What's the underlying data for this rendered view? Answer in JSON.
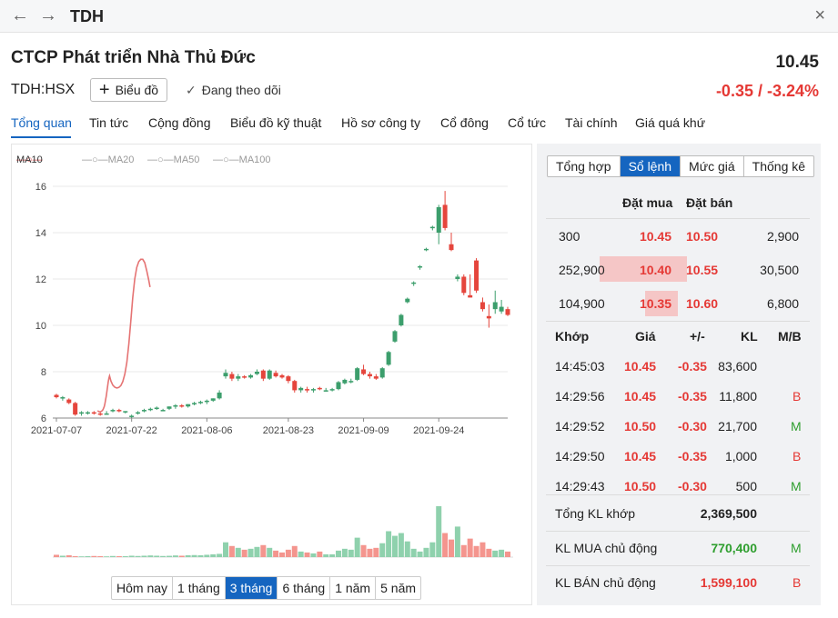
{
  "window": {
    "title": "TDH",
    "back_icon": "←",
    "forward_icon": "→",
    "close_icon": "×"
  },
  "header": {
    "company": "CTCP Phát triển Nhà Thủ Đức",
    "price": "10.45",
    "ticker": "TDH:HSX",
    "chart_button": "Biểu đồ",
    "follow_label": "Đang theo dõi",
    "change": "-0.35 / -3.24%"
  },
  "tabs": [
    "Tổng quan",
    "Tin tức",
    "Cộng đồng",
    "Biểu đồ kỹ thuật",
    "Hồ sơ công ty",
    "Cổ đông",
    "Cổ tức",
    "Tài chính",
    "Giá quá khứ"
  ],
  "legend": [
    "MA10",
    "MA20",
    "MA50",
    "MA100"
  ],
  "ranges": [
    "Hôm nay",
    "1 tháng",
    "3 tháng",
    "6 tháng",
    "1 năm",
    "5 năm"
  ],
  "right_tabs": [
    "Tổng hợp",
    "Sổ lệnh",
    "Mức giá",
    "Thống kê"
  ],
  "orderbook": {
    "buy_header": "Đặt mua",
    "sell_header": "Đặt bán",
    "rows": [
      {
        "buy_vol": "300",
        "buy_price": "10.45",
        "sell_price": "10.50",
        "sell_vol": "2,900"
      },
      {
        "buy_vol": "252,900",
        "buy_price": "10.40",
        "sell_price": "10.55",
        "sell_vol": "30,500"
      },
      {
        "buy_vol": "104,900",
        "buy_price": "10.35",
        "sell_price": "10.60",
        "sell_vol": "6,800"
      }
    ]
  },
  "trades": {
    "headers": [
      "Khớp",
      "Giá",
      "+/-",
      "KL",
      "M/B"
    ],
    "rows": [
      {
        "time": "14:45:03",
        "price": "10.45",
        "change": "-0.35",
        "vol": "83,600",
        "side": ""
      },
      {
        "time": "14:29:56",
        "price": "10.45",
        "change": "-0.35",
        "vol": "11,800",
        "side": "B"
      },
      {
        "time": "14:29:52",
        "price": "10.50",
        "change": "-0.30",
        "vol": "21,700",
        "side": "M"
      },
      {
        "time": "14:29:50",
        "price": "10.45",
        "change": "-0.35",
        "vol": "1,000",
        "side": "B"
      },
      {
        "time": "14:29:43",
        "price": "10.50",
        "change": "-0.30",
        "vol": "500",
        "side": "M"
      }
    ]
  },
  "totals": [
    {
      "label": "Tổng KL khớp",
      "value": "2,369,500",
      "side": ""
    },
    {
      "label": "KL MUA chủ động",
      "value": "770,400",
      "side": "M"
    },
    {
      "label": "KL BÁN chủ động",
      "value": "1,599,100",
      "side": "B"
    }
  ],
  "chart_data": {
    "type": "candlestick",
    "ylim": [
      6,
      16.5
    ],
    "yticks": [
      "6",
      "8",
      "10",
      "12",
      "14",
      "16"
    ],
    "xticks": [
      "2021-07-07",
      "2021-07-22",
      "2021-08-06",
      "2021-08-23",
      "2021-09-09",
      "2021-09-24"
    ],
    "ohlc": [
      [
        7.0,
        7.05,
        6.85,
        6.9
      ],
      [
        6.85,
        6.95,
        6.75,
        6.9
      ],
      [
        6.8,
        6.85,
        6.6,
        6.65
      ],
      [
        6.65,
        6.7,
        6.1,
        6.15
      ],
      [
        6.2,
        6.3,
        6.1,
        6.25
      ],
      [
        6.2,
        6.3,
        6.15,
        6.25
      ],
      [
        6.25,
        6.3,
        6.15,
        6.2
      ],
      [
        6.2,
        6.25,
        6.1,
        6.15
      ],
      [
        6.2,
        6.3,
        6.15,
        6.2
      ],
      [
        6.3,
        6.4,
        6.25,
        6.35
      ],
      [
        6.35,
        6.4,
        6.25,
        6.3
      ],
      [
        6.25,
        6.3,
        6.2,
        6.3
      ],
      [
        6.1,
        6.15,
        6.0,
        6.1
      ],
      [
        6.2,
        6.3,
        6.15,
        6.25
      ],
      [
        6.3,
        6.4,
        6.25,
        6.35
      ],
      [
        6.35,
        6.45,
        6.3,
        6.4
      ],
      [
        6.4,
        6.5,
        6.35,
        6.45
      ],
      [
        6.35,
        6.4,
        6.3,
        6.35
      ],
      [
        6.4,
        6.5,
        6.35,
        6.5
      ],
      [
        6.5,
        6.6,
        6.4,
        6.55
      ],
      [
        6.55,
        6.6,
        6.45,
        6.5
      ],
      [
        6.5,
        6.6,
        6.45,
        6.6
      ],
      [
        6.6,
        6.7,
        6.55,
        6.65
      ],
      [
        6.65,
        6.75,
        6.6,
        6.7
      ],
      [
        6.7,
        6.8,
        6.6,
        6.75
      ],
      [
        6.75,
        6.85,
        6.7,
        6.85
      ],
      [
        6.85,
        7.2,
        6.8,
        7.1
      ],
      [
        7.8,
        8.1,
        7.7,
        7.95
      ],
      [
        7.9,
        8.0,
        7.6,
        7.7
      ],
      [
        7.7,
        7.9,
        7.6,
        7.8
      ],
      [
        7.8,
        7.85,
        7.7,
        7.75
      ],
      [
        7.75,
        7.9,
        7.7,
        7.85
      ],
      [
        7.9,
        8.1,
        7.85,
        8.0
      ],
      [
        8.05,
        8.1,
        7.6,
        7.7
      ],
      [
        7.7,
        8.1,
        7.65,
        8.05
      ],
      [
        7.95,
        8.05,
        7.75,
        7.8
      ],
      [
        7.85,
        7.9,
        7.7,
        7.75
      ],
      [
        7.8,
        7.85,
        7.5,
        7.6
      ],
      [
        7.6,
        7.65,
        7.1,
        7.2
      ],
      [
        7.2,
        7.35,
        7.1,
        7.3
      ],
      [
        7.25,
        7.35,
        7.1,
        7.2
      ],
      [
        7.2,
        7.3,
        7.1,
        7.25
      ],
      [
        7.3,
        7.35,
        7.2,
        7.25
      ],
      [
        7.2,
        7.3,
        7.15,
        7.2
      ],
      [
        7.2,
        7.3,
        7.15,
        7.25
      ],
      [
        7.25,
        7.6,
        7.2,
        7.55
      ],
      [
        7.5,
        7.7,
        7.45,
        7.65
      ],
      [
        7.6,
        7.7,
        7.5,
        7.6
      ],
      [
        7.65,
        8.2,
        7.6,
        8.15
      ],
      [
        8.1,
        8.3,
        7.85,
        7.9
      ],
      [
        7.9,
        8.0,
        7.7,
        7.8
      ],
      [
        7.8,
        7.9,
        7.65,
        7.7
      ],
      [
        7.75,
        8.2,
        7.7,
        8.15
      ],
      [
        8.3,
        8.9,
        8.25,
        8.85
      ],
      [
        9.3,
        9.8,
        9.25,
        9.75
      ],
      [
        10.0,
        10.5,
        9.95,
        10.45
      ],
      [
        11.0,
        11.2,
        10.95,
        11.15
      ],
      [
        11.8,
        11.9,
        11.7,
        11.85
      ],
      [
        12.5,
        12.6,
        12.4,
        12.55
      ],
      [
        13.3,
        13.35,
        13.2,
        13.3
      ],
      [
        14.2,
        14.3,
        14.1,
        14.25
      ],
      [
        14.0,
        15.2,
        13.5,
        15.1
      ],
      [
        15.2,
        15.8,
        14.1,
        14.2
      ],
      [
        13.5,
        14.0,
        13.2,
        13.25
      ],
      [
        12.0,
        12.2,
        11.9,
        12.1
      ],
      [
        12.1,
        12.2,
        11.3,
        11.4
      ],
      [
        11.3,
        12.2,
        11.2,
        11.2
      ],
      [
        12.8,
        12.9,
        11.4,
        11.5
      ],
      [
        11.0,
        11.2,
        10.6,
        10.7
      ],
      [
        10.4,
        10.9,
        9.9,
        10.3
      ],
      [
        10.7,
        11.5,
        10.5,
        11.0
      ],
      [
        10.6,
        11.1,
        10.5,
        10.8
      ],
      [
        10.7,
        10.8,
        10.4,
        10.45
      ]
    ],
    "volume": [
      0.25,
      0.15,
      0.2,
      0.1,
      0.08,
      0.1,
      0.12,
      0.1,
      0.08,
      0.12,
      0.1,
      0.1,
      0.15,
      0.12,
      0.15,
      0.18,
      0.15,
      0.12,
      0.14,
      0.18,
      0.15,
      0.2,
      0.22,
      0.2,
      0.25,
      0.3,
      0.35,
      1.6,
      1.2,
      1.0,
      0.8,
      0.9,
      1.1,
      1.3,
      1.0,
      0.7,
      0.5,
      0.8,
      1.2,
      0.6,
      0.5,
      0.4,
      0.6,
      0.3,
      0.3,
      0.7,
      0.9,
      0.8,
      2.1,
      1.3,
      0.9,
      1.0,
      1.5,
      2.8,
      2.3,
      2.6,
      1.7,
      0.9,
      0.6,
      1.0,
      1.6,
      5.5,
      2.6,
      1.9,
      3.3,
      1.3,
      2.0,
      1.2,
      1.6,
      0.9,
      0.7,
      0.8,
      0.6
    ],
    "ma10": [
      [
        7.2,
        6.32
      ],
      [
        7.3,
        6.3
      ],
      [
        7.4,
        6.28
      ],
      [
        7.5,
        6.27
      ],
      [
        7.6,
        6.27
      ],
      [
        7.7,
        6.28
      ],
      [
        7.8,
        6.3
      ],
      [
        7.9,
        6.32
      ],
      [
        8.0,
        6.36
      ],
      [
        8.1,
        6.42
      ],
      [
        8.2,
        6.5
      ],
      [
        8.3,
        6.62
      ],
      [
        8.4,
        6.78
      ],
      [
        8.5,
        6.95
      ],
      [
        8.6,
        7.15
      ],
      [
        8.7,
        7.35
      ],
      [
        8.8,
        7.55
      ],
      [
        8.9,
        7.72
      ],
      [
        9.0,
        7.82
      ],
      [
        9.2,
        7.6
      ],
      [
        9.5,
        7.42
      ],
      [
        9.8,
        7.33
      ],
      [
        10.1,
        7.3
      ],
      [
        10.4,
        7.32
      ],
      [
        10.7,
        7.4
      ],
      [
        11.0,
        7.58
      ],
      [
        11.3,
        7.9
      ],
      [
        11.6,
        8.4
      ],
      [
        11.9,
        9.2
      ],
      [
        12.2,
        10.2
      ],
      [
        12.5,
        11.2
      ],
      [
        12.8,
        12.0
      ],
      [
        13.1,
        12.5
      ],
      [
        13.4,
        12.75
      ],
      [
        13.7,
        12.85
      ],
      [
        14.0,
        12.85
      ],
      [
        14.3,
        12.7
      ],
      [
        14.6,
        12.35
      ],
      [
        14.9,
        11.95
      ],
      [
        15.1,
        11.65
      ]
    ]
  }
}
